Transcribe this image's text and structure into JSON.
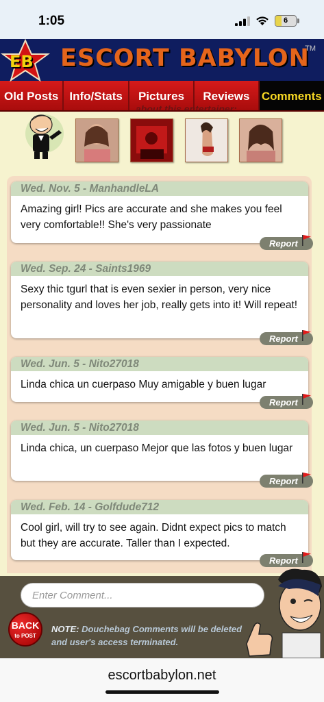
{
  "status": {
    "time": "1:05",
    "battery": "6",
    "battery_level": 0.06
  },
  "header": {
    "logo": "EB",
    "title": "ESCORT  BABYLON",
    "tm": "TM"
  },
  "tabs": [
    {
      "label": "Old Posts"
    },
    {
      "label": "Info/Stats"
    },
    {
      "label": "Pictures"
    },
    {
      "label": "Reviews"
    },
    {
      "label": "Comments"
    }
  ],
  "subheading": "about this entertainer:",
  "comments": [
    {
      "header": "Wed. Nov. 5 - ManhandleLA",
      "text": "Amazing girl! Pics are accurate and she makes you feel very comfortable!! She's very passionate",
      "report": "Report"
    },
    {
      "header": "Wed. Sep. 24 - Saints1969",
      "text": "Sexy thic tgurl that is even sexier in person, very nice personality and loves her job, really gets into it! Will repeat!",
      "report": "Report"
    },
    {
      "header": "Wed. Jun. 5 - Nito27018",
      "text": "Linda chica un cuerpaso Muy amigable y buen lugar",
      "report": "Report"
    },
    {
      "header": "Wed. Jun. 5 - Nito27018",
      "text": "Linda chica, un cuerpaso Mejor que las fotos y buen lugar",
      "report": "Report"
    },
    {
      "header": "Wed. Feb. 14 - Golfdude712",
      "text": "Cool girl, will try to see again. Didnt expect pics to match but they are accurate. Taller than I expected.",
      "report": "Report"
    }
  ],
  "footer": {
    "input_placeholder": "Enter Comment...",
    "back_top": "BACK",
    "back_bottom": "to POST",
    "note_label": "NOTE:",
    "note_text": " Douchebag Comments will be deleted and user's access terminated."
  },
  "url": "escortbabylon.net",
  "colors": {
    "header_bg": "#0f1d5f",
    "title": "#e5651b",
    "tab_red": "#c01010",
    "tab_active_text": "#f7d823",
    "comment_head": "#cddcc0"
  }
}
